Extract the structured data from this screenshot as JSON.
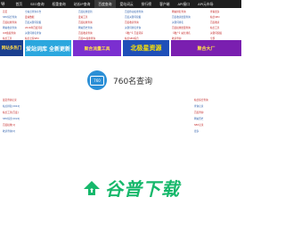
{
  "nav": {
    "logo": "导",
    "items": [
      "首页",
      "SEO查询",
      "权重查询",
      "站长IP查询",
      "百度查询",
      "爱站词云",
      "排行榜",
      "客户端",
      "API接口",
      "API元市场"
    ],
    "active_index": 4
  },
  "link_columns": [
    {
      "lines": [
        {
          "t": "首页"
        },
        {
          "t": "SEO综合查询",
          "b": true
        },
        {
          "t": "百度权重查询"
        },
        {
          "t": "网站收录查询",
          "b": true
        },
        {
          "t": "ICP备案查询"
        },
        {
          "t": "站长工具"
        }
      ]
    },
    {
      "lines": [
        {
          "t": "全站点查询平台",
          "b": true
        },
        {
          "t": "爱站数据"
        },
        {
          "t": "百度关键词挖掘",
          "b": true
        },
        {
          "t": "2016年百度词库"
        },
        {
          "t": "关键词排名查询",
          "b": true
        },
        {
          "t": "站长之家SEO"
        }
      ]
    },
    {
      "lines": [
        {
          "t": "百度权重更新",
          "b": true
        },
        {
          "t": "爱站工具"
        },
        {
          "t": "百度权重查询"
        },
        {
          "t": "网站历史查询",
          "b": true
        },
        {
          "t": "百度收录查询"
        },
        {
          "t": "百度PC权重查询"
        }
      ]
    },
    {
      "lines": [
        {
          "t": "百度移动权重查询",
          "b": true
        },
        {
          "t": "百度关键词挖掘",
          "b": true
        },
        {
          "t": "百度收录查询"
        },
        {
          "t": "关键词排名查询",
          "b": true
        },
        {
          "t": "【推广】百度词库"
        },
        {
          "t": "站长SEO综合"
        }
      ]
    },
    {
      "lines": [
        {
          "t": "网站排名查询"
        },
        {
          "t": "百度收录批量查询",
          "b": true
        },
        {
          "t": "关键词排名",
          "b": true
        },
        {
          "t": "百度权重批量查询"
        },
        {
          "t": "【推广】站长排名"
        },
        {
          "t": "收录查询"
        }
      ]
    },
    {
      "lines": [
        {
          "t": "查看更多"
        },
        {
          "t": "站长SEO"
        },
        {
          "t": "百度收录"
        },
        {
          "t": "站长工具"
        },
        {
          "t": "关键词挖掘"
        },
        {
          "t": "全部"
        }
      ]
    }
  ],
  "banners": [
    {
      "text": "网站多热门",
      "bg": "#1b3f8f",
      "fg": "#ffd84a"
    },
    {
      "text": "爱站词库 全新更新",
      "bg": "#2ba7de",
      "fg": "#ffffff"
    },
    {
      "text": "聚合流量工具",
      "bg": "#7b2fd0",
      "fg": "#ffe04a"
    },
    {
      "text": "北极星资源",
      "bg": "#1f4fb8",
      "fg": "#ffe400"
    },
    {
      "text": "聚合大厂",
      "bg": "#7a1fb0",
      "fg": "#ffe04a"
    }
  ],
  "site": {
    "logo_text": "760",
    "name": "760名查询"
  },
  "lower_lines": {
    "left": [
      "最近查询记录",
      "站点排名[2024]",
      "站长工具[百度]",
      "SEO综合[2024]",
      "百度权重[1]",
      "收录查询[2]"
    ],
    "right": [
      "站长综合查询",
      "查询记录",
      "百度查询",
      "网站历史",
      "SEO记录",
      "更多"
    ]
  },
  "watermark": {
    "text": "谷普下载",
    "color": "#16b86b"
  }
}
